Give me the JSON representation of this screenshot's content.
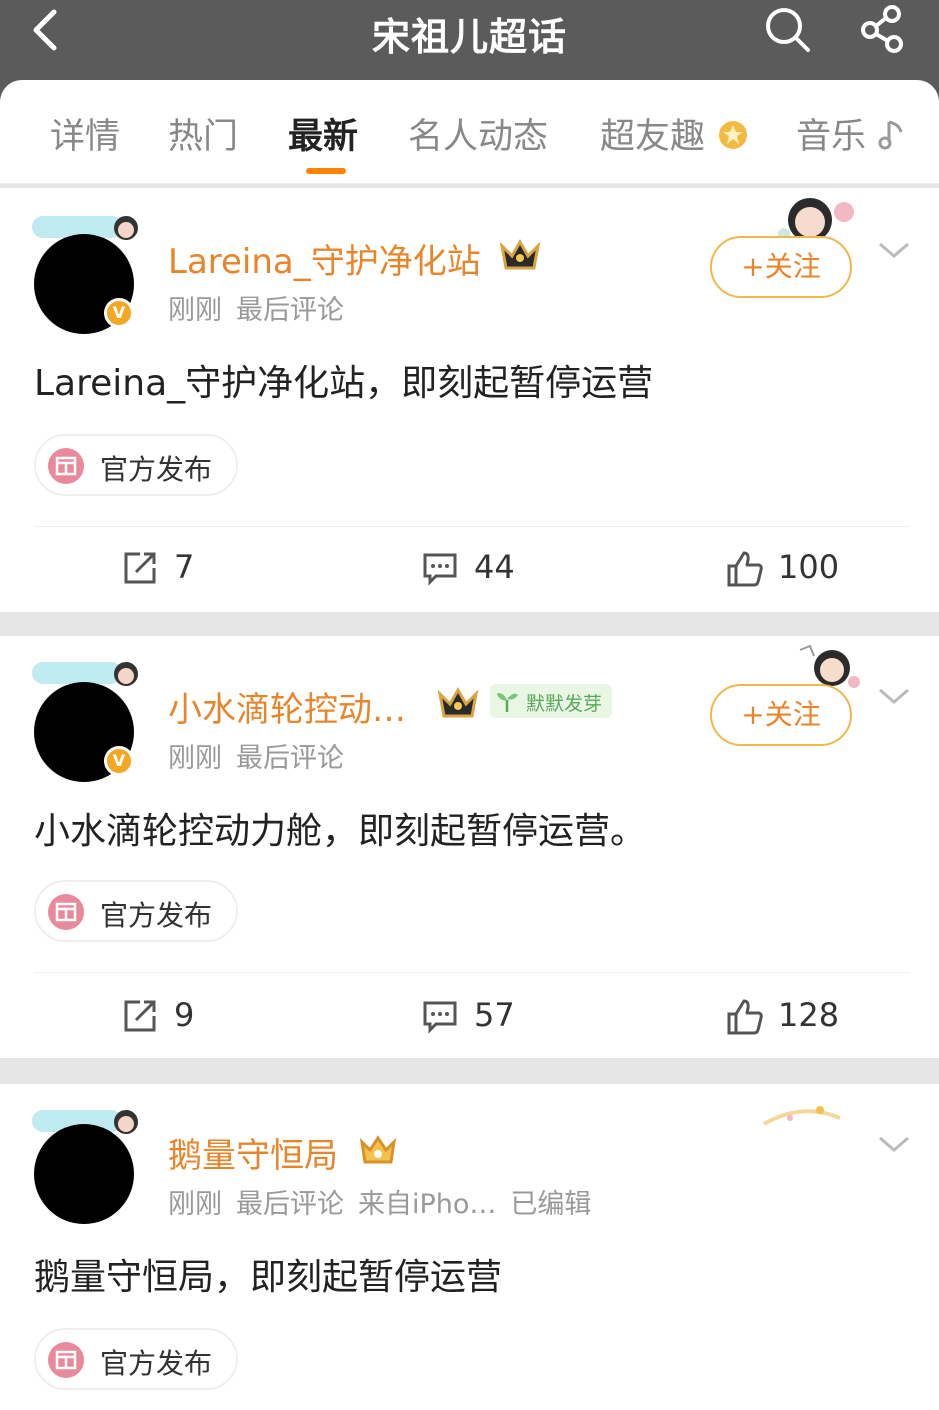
{
  "header": {
    "title": "宋祖儿超话"
  },
  "tabs": [
    {
      "label": "详情"
    },
    {
      "label": "热门"
    },
    {
      "label": "最新"
    },
    {
      "label": "名人动态"
    },
    {
      "label": "超友趣"
    },
    {
      "label": "音乐"
    }
  ],
  "active_tab": "最新",
  "posts": [
    {
      "username": "Lareina_守护净化站",
      "meta": [
        "刚刚",
        "最后评论"
      ],
      "follow_label": "+关注",
      "text": "Lareina_守护净化站，即刻起暂停运营",
      "tag_label": "官方发布",
      "repost_count": "7",
      "comment_count": "44",
      "like_count": "100"
    },
    {
      "username": "小水滴轮控动…",
      "badge_label": "默默发芽",
      "meta": [
        "刚刚",
        "最后评论"
      ],
      "follow_label": "+关注",
      "text": "小水滴轮控动力舱，即刻起暂停运营。",
      "tag_label": "官方发布",
      "repost_count": "9",
      "comment_count": "57",
      "like_count": "128"
    },
    {
      "username": "鹅量守恒局",
      "meta": [
        "刚刚",
        "最后评论",
        "来自iPho…",
        "已编辑"
      ],
      "text": "鹅量守恒局，即刻起暂停运营",
      "tag_label": "官方发布"
    }
  ],
  "colors": {
    "accent": "#ff8200",
    "username": "#e8852b",
    "follow_border": "#f0b84a",
    "header_bg": "#5b5b5b"
  },
  "icons": [
    "back-arrow-icon",
    "search-icon",
    "share-icon",
    "crown-icon",
    "chevron-down-icon",
    "repost-icon",
    "comment-icon",
    "like-icon",
    "official-tag-icon",
    "star-flower-icon",
    "music-note-icon",
    "sprout-icon"
  ]
}
